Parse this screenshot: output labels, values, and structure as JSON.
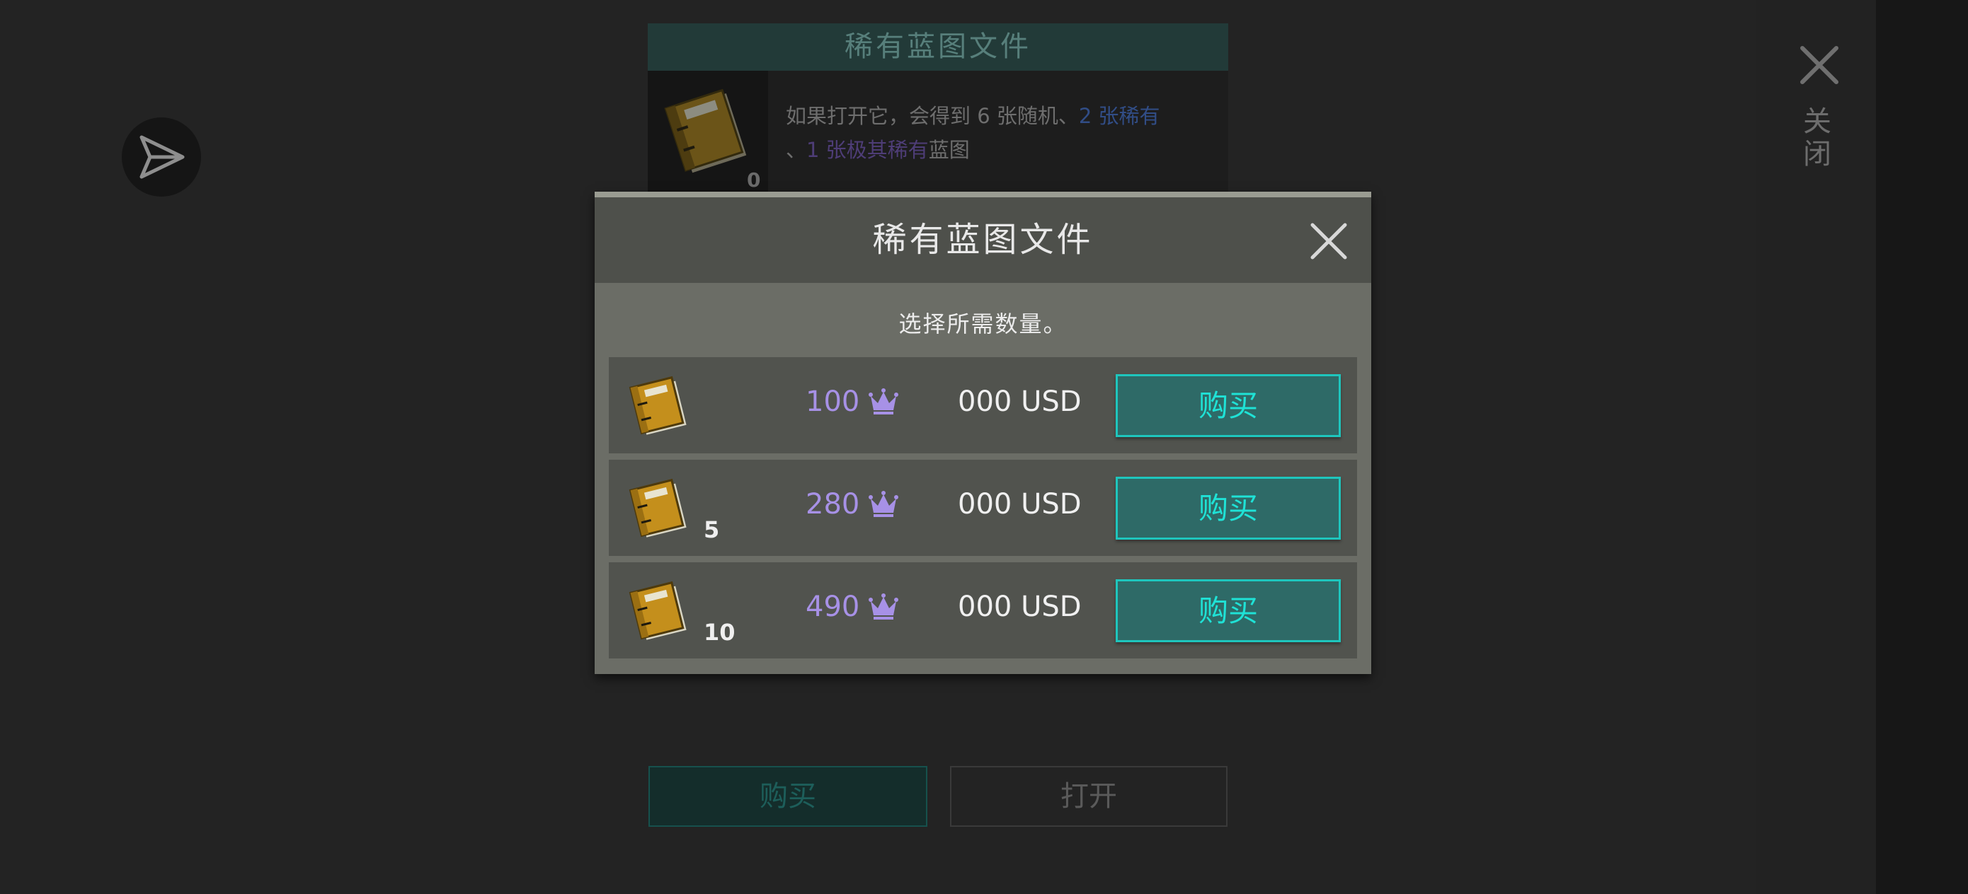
{
  "background": {
    "title": "稀有蓝图文件",
    "owned_count": "0",
    "description": {
      "part1": "如果打开它，会得到 6 张随机、",
      "rare": "2 张稀有",
      "part2": "、",
      "very_rare": "1 张极其稀有",
      "part3": "蓝图"
    },
    "buy_label": "购买",
    "open_label": "打开"
  },
  "side": {
    "close_label": "关闭"
  },
  "modal": {
    "title": "稀有蓝图文件",
    "subtitle": "选择所需数量。",
    "rows": [
      {
        "qty": "",
        "price": "100",
        "usd": "000 USD",
        "buy_label": "购买"
      },
      {
        "qty": "5",
        "price": "280",
        "usd": "000 USD",
        "buy_label": "购买"
      },
      {
        "qty": "10",
        "price": "490",
        "usd": "000 USD",
        "buy_label": "购买"
      }
    ]
  },
  "colors": {
    "accent": "#1fe2d6",
    "price": "#a791e6",
    "rare": "#314d86",
    "very_rare": "#4e3d77"
  },
  "icons": [
    "send-icon",
    "close-icon",
    "blueprint-folder-icon",
    "crown-icon"
  ]
}
